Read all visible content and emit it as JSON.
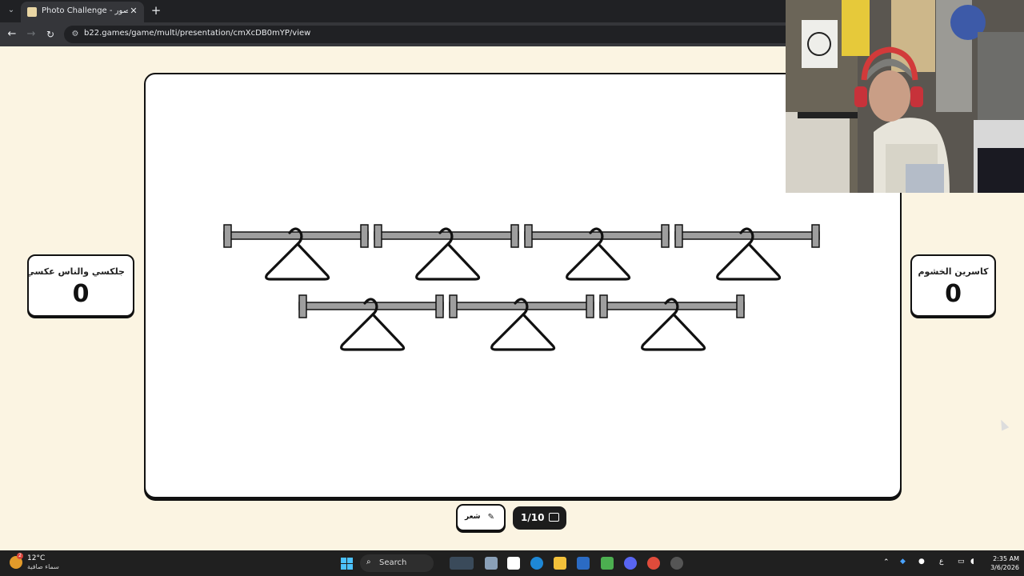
{
  "browser": {
    "tab_title": "Photo Challenge - تحدي الصور",
    "url": "b22.games/game/multi/presentation/cmXcDB0mYP/view"
  },
  "teams": {
    "left": {
      "name": "جلكسي والناس عكسي",
      "score": "0"
    },
    "right": {
      "name": "كاسرين الخشوم",
      "score": "0"
    }
  },
  "puzzle": {
    "row1_hangers": 4,
    "row2_hangers": 3
  },
  "footer": {
    "category_label": "شعر",
    "progress_label": "1/10"
  },
  "taskbar": {
    "weather_temp": "12°C",
    "weather_desc": "سماء صافية",
    "weather_badge": "2",
    "search_label": "Search",
    "lang": "ع",
    "time": "2:35 AM",
    "date": "3/6/2026"
  },
  "colors": {
    "page_bg": "#fbf4e2",
    "card_border": "#111111",
    "rod_gray": "#9e9e9e"
  }
}
